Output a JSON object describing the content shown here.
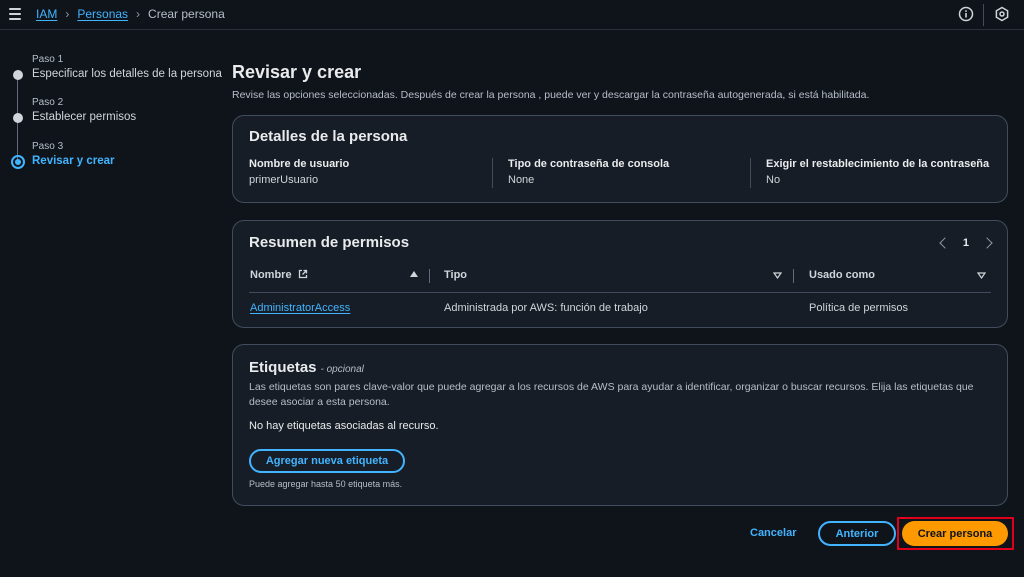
{
  "breadcrumb": {
    "iam": "IAM",
    "personas": "Personas",
    "current": "Crear persona"
  },
  "stepper": {
    "steps": [
      {
        "small": "Paso 1",
        "title": "Especificar los detalles de la persona"
      },
      {
        "small": "Paso 2",
        "title": "Establecer permisos"
      },
      {
        "small": "Paso 3",
        "title": "Revisar y crear"
      }
    ]
  },
  "main": {
    "title": "Revisar y crear",
    "description": "Revise las opciones seleccionadas. Después de crear la persona , puede ver y descargar la contraseña autogenerada, si está habilitada."
  },
  "details": {
    "heading": "Detalles de la persona",
    "fields": [
      {
        "label": "Nombre de usuario",
        "value": "primerUsuario"
      },
      {
        "label": "Tipo de contraseña de consola",
        "value": "None"
      },
      {
        "label": "Exigir el restablecimiento de la contraseña",
        "value": "No"
      }
    ]
  },
  "permissions": {
    "heading": "Resumen de permisos",
    "page": "1",
    "columns": [
      "Nombre",
      "Tipo",
      "Usado como"
    ],
    "rows": [
      [
        "AdministratorAccess",
        "Administrada por AWS: función de trabajo",
        "Política de permisos"
      ]
    ]
  },
  "tags": {
    "heading": "Etiquetas",
    "optional": "- opcional",
    "description": "Las etiquetas son pares clave-valor que puede agregar a los recursos de AWS para ayudar a identificar, organizar o buscar recursos. Elija las etiquetas que desee asociar a esta persona.",
    "empty": "No hay etiquetas asociadas al recurso.",
    "add_button": "Agregar nueva etiqueta",
    "limit": "Puede agregar hasta 50 etiqueta más."
  },
  "footer": {
    "cancel": "Cancelar",
    "previous": "Anterior",
    "create": "Crear persona"
  },
  "colors": {
    "accent": "#42b4ff",
    "primary": "#ff9900",
    "highlight": "#e0001b"
  }
}
